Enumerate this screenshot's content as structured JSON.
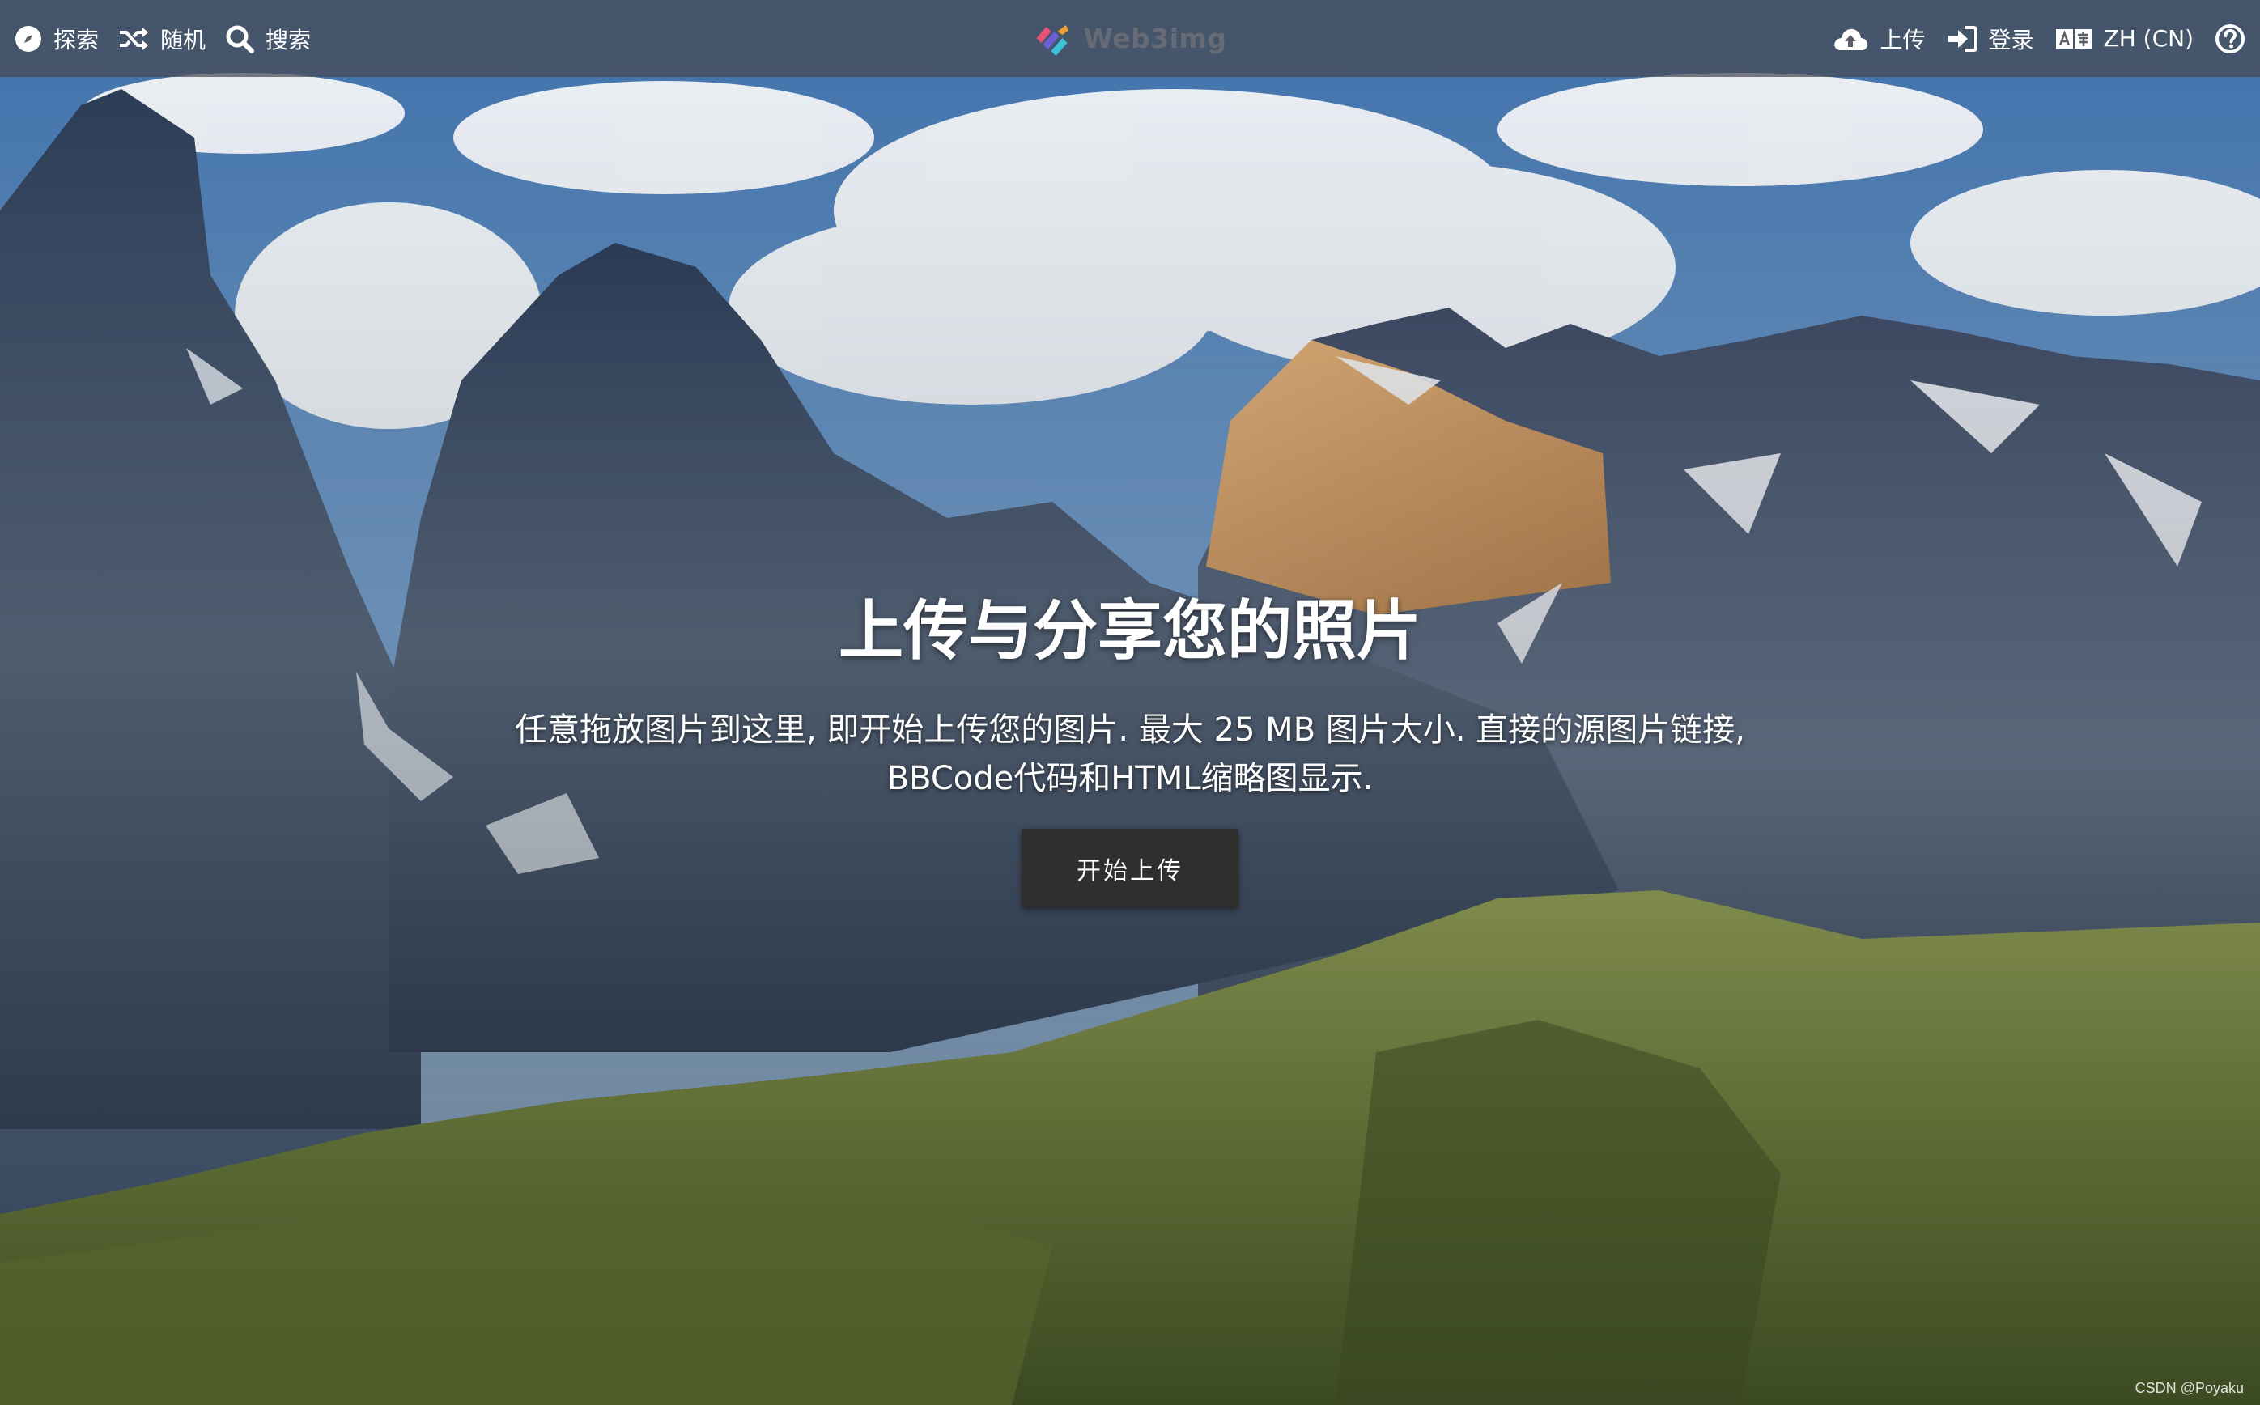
{
  "nav": {
    "left": [
      {
        "label": "探索",
        "icon": "compass-icon"
      },
      {
        "label": "随机",
        "icon": "shuffle-icon"
      },
      {
        "label": "搜索",
        "icon": "search-icon"
      }
    ],
    "brand": "Web3img",
    "right": [
      {
        "label": "上传",
        "icon": "cloud-upload-icon"
      },
      {
        "label": "登录",
        "icon": "sign-in-icon"
      },
      {
        "label": "ZH (CN)",
        "icon": "language-icon"
      },
      {
        "label": "",
        "icon": "help-circle-icon"
      }
    ]
  },
  "hero": {
    "title": "上传与分享您的照片",
    "description": "任意拖放图片到这里, 即开始上传您的图片. 最大 25 MB 图片大小. 直接的源图片链接, BBCode代码和HTML缩略图显示.",
    "button_label": "开始上传"
  },
  "watermark": "CSDN @Poyaku",
  "colors": {
    "topbar_bg": "#464a52",
    "button_bg": "#2f2f30",
    "text": "#ffffff"
  }
}
